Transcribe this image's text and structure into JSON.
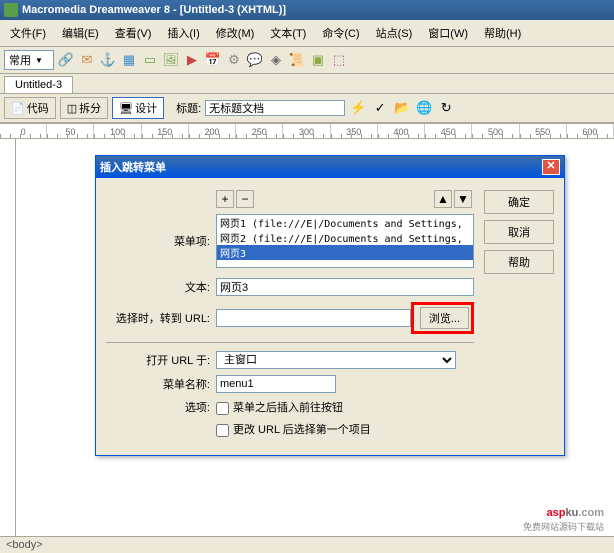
{
  "titlebar": {
    "text": "Macromedia Dreamweaver 8 - [Untitled-3 (XHTML)]"
  },
  "menu": {
    "file": "文件(F)",
    "edit": "编辑(E)",
    "view": "查看(V)",
    "insert": "插入(I)",
    "modify": "修改(M)",
    "text": "文本(T)",
    "commands": "命令(C)",
    "site": "站点(S)",
    "window": "窗口(W)",
    "help": "帮助(H)"
  },
  "toolbar_mode": "常用",
  "doc_tab": "Untitled-3",
  "view": {
    "code": "代码",
    "split": "拆分",
    "design": "设计",
    "title_label": "标题:",
    "title_value": "无标题文档"
  },
  "ruler": [
    "0",
    "50",
    "100",
    "150",
    "200",
    "250",
    "300",
    "350",
    "400",
    "450",
    "500",
    "550",
    "600"
  ],
  "dialog": {
    "title": "插入跳转菜单",
    "menu_items_label": "菜单项:",
    "items": [
      "网页1 (file:///E|/Documents and Settings,",
      "网页2 (file:///E|/Documents and Settings,",
      "网页3"
    ],
    "text_label": "文本:",
    "text_value": "网页3",
    "url_label": "选择时，转到 URL:",
    "url_value": "",
    "browse": "浏览...",
    "open_in_label": "打开 URL 于:",
    "open_in_value": "主窗口",
    "menu_name_label": "菜单名称:",
    "menu_name_value": "menu1",
    "options_label": "选项:",
    "opt1": "菜单之后插入前往按钮",
    "opt2": "更改 URL 后选择第一个项目",
    "ok": "确定",
    "cancel": "取消",
    "help": "帮助"
  },
  "status": "<body>",
  "watermark_sub": "免费网站源码下载站"
}
